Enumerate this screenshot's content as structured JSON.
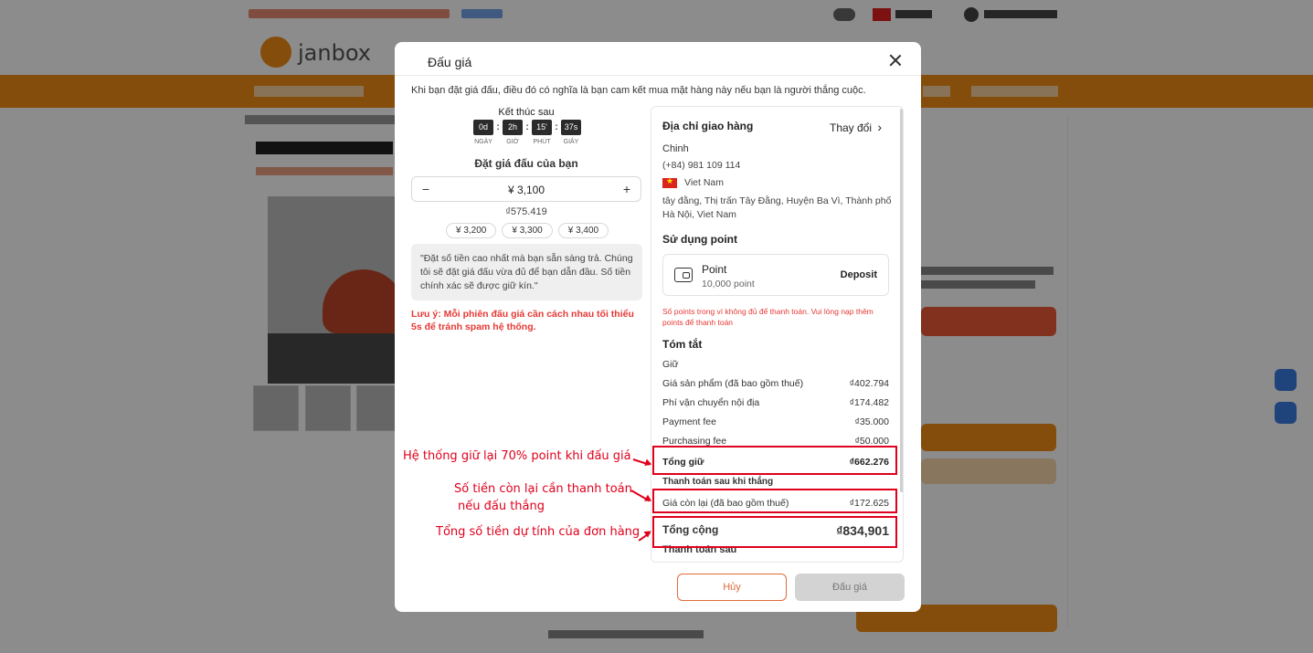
{
  "modal": {
    "title": "Đấu giá",
    "intro": "Khi bạn đặt giá đấu, điều đó có nghĩa là bạn cam kết mua mặt hàng này nếu bạn là người thắng cuộc.",
    "ends_label": "Kết thúc sau",
    "timer": [
      {
        "value": "0d",
        "unit": "NGÀY"
      },
      {
        "value": "2h",
        "unit": "GIỜ"
      },
      {
        "value": "15'",
        "unit": "PHÚT"
      },
      {
        "value": "37s",
        "unit": "GIÂY"
      }
    ],
    "bid_label": "Đặt giá đấu của bạn",
    "bid_value": "¥ 3,100",
    "bid_minus": "−",
    "bid_plus": "+",
    "bid_vnd": "₫575.419",
    "quick_bids": [
      "¥ 3,200",
      "¥ 3,300",
      "¥ 3,400"
    ],
    "note": "\"Đặt số tiền cao nhất mà bạn sẵn sàng trả. Chúng tôi sẽ đặt giá đấu vừa đủ để bạn dẫn đầu. Số tiền chính xác sẽ được giữ kín.\"",
    "warning": "Lưu ý: Mỗi phiên đấu giá cần cách nhau tối thiểu 5s để tránh spam hệ thống.",
    "cancel_label": "Hủy",
    "submit_label": "Đấu giá"
  },
  "shipping": {
    "title": "Địa chỉ giao hàng",
    "change_label": "Thay đổi",
    "change_icon": "chevron-right-icon",
    "name": "Chinh",
    "phone": "(+84) 981 109 114",
    "country": "Viet Nam",
    "address_line1": "tây đằng, Thị trấn Tây Đằng, Huyện Ba Vì, Thành phố",
    "address_line2": "Hà Nội, Viet Nam"
  },
  "points": {
    "title": "Sử dụng point",
    "name": "Point",
    "balance": "10,000 point",
    "deposit_label": "Deposit",
    "warning_line1": "Số points trong ví không đủ để thanh toán. Vui lòng nạp thêm",
    "warning_line2": "points để thanh toán"
  },
  "summary": {
    "title": "Tóm tắt",
    "hold_heading": "Giữ",
    "items": [
      {
        "label": "Giá sản phẩm (đã bao gồm thuế)",
        "value": "₫402.794"
      },
      {
        "label": "Phí vận chuyển nội địa",
        "value": "₫174.482"
      },
      {
        "label": "Payment fee",
        "value": "₫35.000"
      },
      {
        "label": "Purchasing fee",
        "value": "₫50.000"
      }
    ],
    "total_hold_label": "Tổng giữ",
    "total_hold_value": "₫662.276",
    "after_win_heading": "Thanh toán sau khi thắng",
    "remaining_label": "Giá còn lại (đã bao gồm thuế)",
    "remaining_value": "₫172.625",
    "grand_total_label": "Tổng cộng",
    "grand_total_value": "₫834,901",
    "pay_later_label": "Thanh toán sau"
  },
  "annotations": {
    "hold": "Hệ thống giữ lại 70% point khi đấu giá",
    "remaining_line1": "Số tiền còn lại cần thanh toán",
    "remaining_line2": "nếu đấu thắng",
    "total": "Tổng số tiền dự tính của đơn hàng",
    "color": "#e0001b"
  },
  "background": {
    "logo_text": "janbox",
    "brand_color": "#f28c14"
  }
}
